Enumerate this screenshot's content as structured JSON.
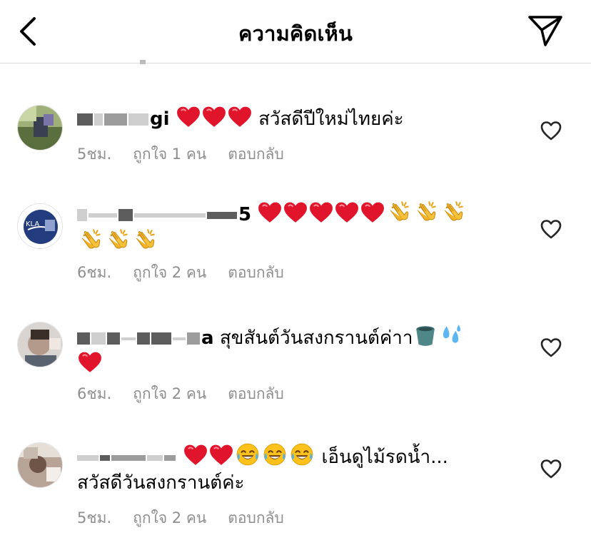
{
  "header": {
    "title": "ความคิดเห็น"
  },
  "comments": [
    {
      "username_visible": "gi",
      "text": "สวัสดีปีใหม่ไทยค่ะ",
      "time": "5ชม.",
      "likes": "ถูกใจ 1 คน",
      "reply": "ตอบกลับ",
      "emojis": [
        "red-heart",
        "red-heart",
        "red-heart"
      ]
    },
    {
      "username_visible": "5",
      "text": "",
      "time": "6ชม.",
      "likes": "ถูกใจ 2 คน",
      "reply": "ตอบกลับ",
      "emojis": [
        "red-heart",
        "red-heart",
        "red-heart",
        "red-heart",
        "red-heart",
        "clapping-hands",
        "clapping-hands",
        "clapping-hands",
        "clapping-hands",
        "clapping-hands",
        "clapping-hands"
      ],
      "avatar_text": "KLA"
    },
    {
      "username_visible": "a",
      "text": "สุขสันต์วันสงกรานต์ค่าา",
      "time": "6ชม.",
      "likes": "ถูกใจ 2 คน",
      "reply": "ตอบกลับ",
      "emojis": [
        "bucket",
        "sweat-droplets",
        "red-heart"
      ]
    },
    {
      "username_visible": "",
      "text": "เอ็นดูไม้รดน้ำ...",
      "text_line2": "สวัสดีวันสงกรานต์ค่ะ",
      "time": "5ชม.",
      "likes": "ถูกใจ 2 คน",
      "reply": "ตอบกลับ",
      "emojis": [
        "red-heart",
        "red-heart",
        "face-with-tears-of-joy",
        "face-with-tears-of-joy",
        "face-with-tears-of-joy"
      ]
    }
  ],
  "icons": {
    "back": "chevron-left-icon",
    "send": "paper-plane-icon",
    "like": "heart-outline-icon"
  },
  "colors": {
    "secondary_text": "#8e8e8e",
    "heart": "#e0142b",
    "divider": "#dbdbdb"
  }
}
